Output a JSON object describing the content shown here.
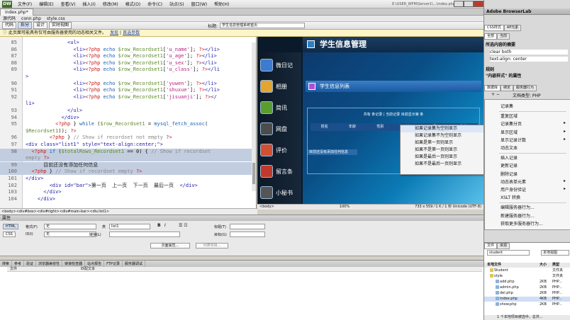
{
  "app": {
    "logo": "DW",
    "menu": [
      "文件(F)",
      "编辑(E)",
      "查看(V)",
      "插入(I)",
      "修改(M)",
      "格式(O)",
      "命令(C)",
      "站点(S)",
      "窗口(W)",
      "帮助(H)"
    ],
    "path": "E:\\USER_WFM\\Server1\\...\\index.php",
    "panel_title": "Adobe BrowserLab"
  },
  "document": {
    "tab": "index.php*",
    "related_files": [
      "源代码",
      "conn.php",
      "style.css"
    ],
    "view_buttons": [
      "代码",
      "拆分",
      "设计",
      "实时视图"
    ],
    "title_label": "标题:",
    "title_value": "学生信息管理系统首页"
  },
  "infobar": {
    "text": "此页面可能具有仅可由服务器使用的动态相关文件。",
    "link1": "发现",
    "link2": "首选参数"
  },
  "code_lines": [
    {
      "n": "85",
      "html": "<span class='tag'>&lt;ul&gt;</span>",
      "indent": "              "
    },
    {
      "n": "86",
      "html": "<span class='tag'>&lt;li&gt;</span><span class='php'>&lt;?php</span> <span class='kw'>echo</span> <span class='var'>$row_Recordset1</span>[<span class='str'>'u_name'</span>]; <span class='php'>?&gt;</span><span class='tag'>&lt;/li&gt;</span>",
      "indent": "                "
    },
    {
      "n": "87",
      "html": "<span class='tag'>&lt;li&gt;</span><span class='php'>&lt;?php</span> <span class='kw'>echo</span> <span class='var'>$row_Recordset1</span>[<span class='str'>'u_age'</span>]; <span class='php'>?&gt;</span><span class='tag'>&lt;/li&gt;</span>",
      "indent": "                "
    },
    {
      "n": "88",
      "html": "<span class='tag'>&lt;li&gt;</span><span class='php'>&lt;?php</span> <span class='kw'>echo</span> <span class='var'>$row_Recordset1</span>[<span class='str'>'u_sex'</span>]; <span class='php'>?&gt;</span><span class='tag'>&lt;/li&gt;</span>",
      "indent": "                "
    },
    {
      "n": "89",
      "html": "<span class='tag'>&lt;li&gt;</span><span class='php'>&lt;?php</span> <span class='kw'>echo</span> <span class='var'>$row_Recordset1</span>[<span class='str'>'u_class'</span>]; <span class='php'>?&gt;</span><span class='tag'>&lt;/li</span>",
      "indent": "                "
    },
    {
      "n": "",
      "html": "<span class='tag'>&gt;</span>",
      "indent": ""
    },
    {
      "n": "90",
      "html": "<span class='tag'>&lt;li&gt;</span><span class='php'>&lt;?php</span> <span class='kw'>echo</span> <span class='var'>$row_Recordset1</span>[<span class='str'>'yuwen'</span>]; <span class='php'>?&gt;</span><span class='tag'>&lt;/li&gt;</span>",
      "indent": "                "
    },
    {
      "n": "91",
      "html": "<span class='tag'>&lt;li&gt;</span><span class='php'>&lt;?php</span> <span class='kw'>echo</span> <span class='var'>$row_Recordset1</span>[<span class='str'>'shuxue'</span>]; <span class='php'>?&gt;</span><span class='tag'>&lt;/li&gt;</span>",
      "indent": "                "
    },
    {
      "n": "92",
      "html": "<span class='tag'>&lt;li&gt;</span><span class='php'>&lt;?php</span> <span class='kw'>echo</span> <span class='var'>$row_Recordset1</span>[<span class='str'>'jisuanji'</span>]; <span class='php'>?&gt;</span><span class='tag'>&lt;/</span>",
      "indent": "                "
    },
    {
      "n": "",
      "html": "<span class='tag'>li&gt;</span>",
      "indent": ""
    },
    {
      "n": "93",
      "html": "<span class='tag'>&lt;/ul&gt;</span>",
      "indent": "              "
    },
    {
      "n": "94",
      "html": "<span class='tag'>&lt;/div&gt;</span>",
      "indent": "            "
    },
    {
      "n": "95",
      "html": "<span class='php'>&lt;?php</span> } <span class='kw'>while</span> (<span class='var'>$row_Recordset1</span> = <span class='kw'>mysql_fetch_assoc</span>(",
      "indent": "          "
    },
    {
      "n": "",
      "html": "<span class='var'>$Recordset1</span>)); <span class='php'>?&gt;</span>",
      "indent": ""
    },
    {
      "n": "96",
      "html": "<span class='php'>&lt;?php</span> } <span class='cmt'>// Show if recordset not empty</span> <span class='php'>?&gt;</span>",
      "indent": "        "
    },
    {
      "n": "97",
      "html": "<span class='tag'>&lt;div class=\"list1\" style=\"text-align:center;\"&gt;</span>",
      "indent": ""
    },
    {
      "n": "98",
      "html": "<span class='php'>&lt;?php</span> <span class='kw'>if</span> (<span class='var'>$totalRows_Recordset1</span> == 0) { <span class='cmt'>// Show if recordset</span>",
      "indent": "  ",
      "sel": true
    },
    {
      "n": "",
      "html": "<span class='cmt'>empty</span> <span class='php'>?&gt;</span>",
      "indent": "",
      "sel": true
    },
    {
      "n": "99",
      "html": "<span class='tx'>目前还没有添加任何信息</span>",
      "indent": "      ",
      "sel": true
    },
    {
      "n": "100",
      "html": "<span class='php'>&lt;?php</span> } <span class='cmt'>// Show if recordset empty</span> <span class='php'>?&gt;</span>",
      "indent": "  ",
      "sel": true
    },
    {
      "n": "101",
      "html": "<span class='tag'>&lt;/div&gt;</span>",
      "indent": ""
    },
    {
      "n": "102",
      "html": "<span class='tag'>&lt;div id=\"bar\"&gt;</span><span class='tx'>第一页  上一页  下一页  最后一页</span>  <span class='tag'>&lt;/div&gt;</span>",
      "indent": "        "
    },
    {
      "n": "103",
      "html": "<span class='tag'>&lt;/div&gt;</span>",
      "indent": "      "
    },
    {
      "n": "104",
      "html": "<span class='tag'>&lt;/div&gt;</span>",
      "indent": "    "
    }
  ],
  "design": {
    "header": "学生信息管理",
    "title_bar": "学生信息列表",
    "side_items": [
      "微日记",
      "相册",
      "简讯",
      "网盘",
      "评价",
      "留言条",
      "小秘书"
    ],
    "summary_text": "共有 条记录 | 当前记录 目前显示第 条",
    "columns": [
      "姓名",
      "年龄",
      "性别",
      "班级",
      "语文",
      "数学"
    ],
    "empty_row": "目前还没有添加任何信息"
  },
  "context_menu": [
    "如果记录集为空则显示",
    "如果记录集不为空则显示",
    "如果是第一页则显示",
    "如果不是第一页则显示",
    "如果是最后一页则显示",
    "如果不是最后一页则显示"
  ],
  "design_status": {
    "left": "<body>",
    "zoom": "100%",
    "right": "733 x 559 ⁄ 1 K / 1 秒 Unicode (UTF-8)"
  },
  "tagbar": "<body><div#box><div#right><div#main-bar><div.list1>",
  "properties": {
    "header": "属性",
    "html_btn": "HTML",
    "css_btn": "CSS",
    "format_label": "格式(F)",
    "format_value": "无",
    "class_label": "类",
    "class_value": "list1",
    "id_label": "ID(I)",
    "id_value": "无",
    "link_label": "链接(L)",
    "title_label": "标题(T)",
    "target_label": "目标(G)",
    "page_props": "页面属性...",
    "list_item": "列表项目..."
  },
  "results": {
    "tabs": [
      "搜索",
      "参考",
      "验证",
      "浏览器兼容性",
      "链接检查器",
      "站点报告",
      "FTP记录",
      "服务器调试"
    ],
    "col_file": "文件",
    "col_desc": "匹配文本"
  },
  "right_panel": {
    "tabs": [
      "CSS样式",
      "AP元素"
    ],
    "tabs2": [
      "全部",
      "当前"
    ],
    "section1": "所选内容的摘要",
    "rule1": "clear       both",
    "rule2": "text-align: center",
    "section2": "规则",
    "section3": "\"内嵌样式\" 的属性",
    "db_tabs": [
      "数据库",
      "绑定",
      "服务器行为"
    ],
    "doc_type": "文档类型: PHP"
  },
  "server_menu": {
    "items": [
      "记录集",
      "重复区域",
      "记录集分页",
      "显示区域",
      "显示记录计数",
      "动态文本",
      "插入记录",
      "更新记录",
      "删除记录",
      "动态表单元素",
      "用户身份验证",
      "XSLT 转换",
      "编辑服务器行为...",
      "新建服务器行为...",
      "获取更多服务器行为..."
    ]
  },
  "files": {
    "tabs": [
      "文件",
      "资源"
    ],
    "site": "student",
    "view": "本地视图",
    "col_name": "本地文件",
    "col_size": "大小",
    "col_type": "类型",
    "rows": [
      {
        "name": "Student",
        "size": "",
        "type": "文件夹",
        "kind": "folder",
        "lvl": 1
      },
      {
        "name": "style",
        "size": "",
        "type": "文件夹",
        "kind": "folder",
        "lvl": 1
      },
      {
        "name": "add.php",
        "size": "2KB",
        "type": "PHP...",
        "kind": "php",
        "lvl": 2
      },
      {
        "name": "admin.php",
        "size": "2KB",
        "type": "PHP...",
        "kind": "php",
        "lvl": 2
      },
      {
        "name": "del.php",
        "size": "2KB",
        "type": "PHP...",
        "kind": "php",
        "lvl": 2
      },
      {
        "name": "index.php",
        "size": "4KB",
        "type": "PHP...",
        "kind": "php",
        "lvl": 2
      },
      {
        "name": "show.php",
        "size": "2KB",
        "type": "PHP...",
        "kind": "php",
        "lvl": 2
      }
    ],
    "status": "1 个本地项目被选中，总共..."
  }
}
